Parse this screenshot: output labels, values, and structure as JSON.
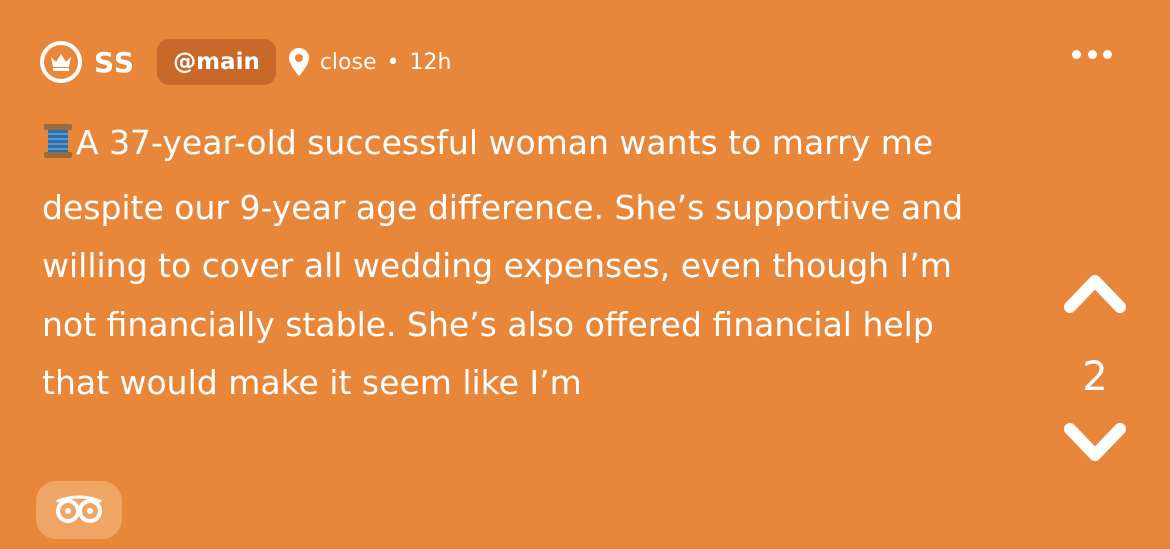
{
  "post": {
    "author": "SS",
    "channel": "@main",
    "location": "close",
    "separator": "•",
    "time": "12h",
    "text": "A 37-year-old successful woman wants to marry me despite our 9-year age difference. She’s supportive and willing to cover all wedding expenses, even though I’m not financially stable. She’s also offered financial help that would make it seem like I’m",
    "text_lead_icon": "spool-of-thread-emoji"
  },
  "votes": {
    "count": "2"
  },
  "icons": {
    "avatar": "crown-icon",
    "location": "map-pin-icon",
    "more": "more-options-icon",
    "upvote": "chevron-up-icon",
    "downvote": "chevron-down-icon",
    "footer": "owl-eyes-icon"
  },
  "colors": {
    "background": "#E8873A",
    "chip": "#C8692A",
    "footer_chip": "#EFA564",
    "text": "#FFFFFF"
  }
}
